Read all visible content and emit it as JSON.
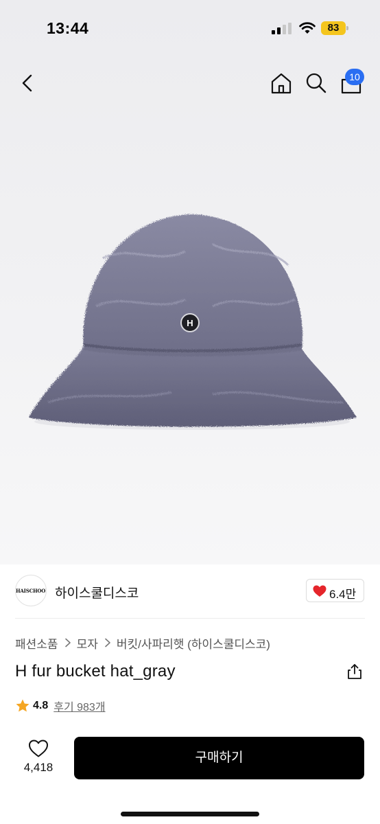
{
  "status_bar": {
    "time": "13:44",
    "battery": "83",
    "battery_color": "#f4c51e"
  },
  "nav": {
    "back_icon": "chevron-left-icon",
    "home_icon": "home-icon",
    "search_icon": "search-icon",
    "cart_icon": "bag-icon",
    "cart_badge": "10",
    "badge_color": "#2a6ef2"
  },
  "product_image": {
    "subject": "fluffy gray bucket hat",
    "logo_letter": "H"
  },
  "shop": {
    "logo_text": "HAISCHOOLDISCO",
    "name": "하이스쿨디스코",
    "like_count": "6.4만"
  },
  "breadcrumb": [
    "패션소품",
    "모자",
    "버킷/사파리햇 (하이스쿨디스코)"
  ],
  "product": {
    "title": "H fur bucket hat_gray",
    "rating": "4.8",
    "reviews": "후기 983개"
  },
  "footer": {
    "wish_count": "4,418",
    "buy_label": "구매하기"
  },
  "colors": {
    "accent_black": "#000000",
    "heart_red": "#e5252b",
    "star_yellow": "#f5a623"
  }
}
